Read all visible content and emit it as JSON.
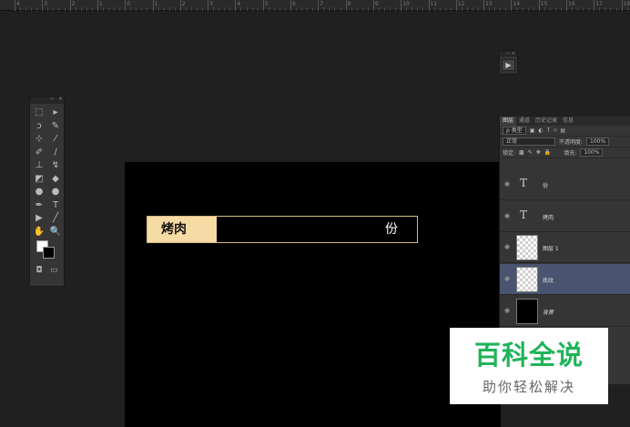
{
  "ruler": {
    "labels": [
      "4",
      "3",
      "2",
      "1",
      "0",
      "1",
      "2",
      "3",
      "4",
      "5",
      "6",
      "7",
      "8",
      "9",
      "10",
      "11",
      "12",
      "13",
      "14",
      "15",
      "16",
      "17",
      "18"
    ]
  },
  "tools_panel": {
    "tool_icons": [
      "marquee-icon",
      "move-icon",
      "lasso-icon",
      "quick-select-icon",
      "crop-icon",
      "eyedropper-icon",
      "healing-icon",
      "brush-icon",
      "stamp-icon",
      "history-brush-icon",
      "eraser-icon",
      "gradient-icon",
      "blur-icon",
      "dodge-icon",
      "pen-icon",
      "type-icon",
      "path-select-icon",
      "line-icon",
      "hand-icon",
      "zoom-icon"
    ],
    "tool_glyphs": [
      "⬚",
      "▸",
      "ↄ",
      "✎",
      "⊹",
      "⁄",
      "✐",
      "∕",
      "⊥",
      "↯",
      "◩",
      "◆",
      "●",
      "●",
      "✒",
      "T",
      "▶",
      "╱",
      "✋",
      "🔍"
    ],
    "foreground_color": "#ffffff",
    "background_color": "#000000"
  },
  "canvas": {
    "strip": {
      "label": "烤肉",
      "unit": "份",
      "label_bg": "#f7dba4",
      "border": "#d8b97a"
    }
  },
  "layers_panel": {
    "tabs": [
      "图层",
      "通道",
      "历史记录",
      "信息"
    ],
    "filter": {
      "label": "ρ 类型",
      "icons": [
        "image-filter-icon",
        "adjust-filter-icon",
        "type-filter-icon",
        "shape-filter-icon",
        "smart-filter-icon"
      ]
    },
    "blend_mode": "正常",
    "opacity_label": "不透明度:",
    "opacity_value": "100%",
    "lock_label": "锁定:",
    "fill_label": "填充:",
    "fill_value": "100%",
    "layers": [
      {
        "name": "份",
        "type": "text",
        "selected": false
      },
      {
        "name": "烤肉",
        "type": "text",
        "selected": false
      },
      {
        "name": "图层 1",
        "type": "pixel",
        "selected": false
      },
      {
        "name": "底纹",
        "type": "pixel",
        "selected": true
      },
      {
        "name": "背景",
        "type": "background",
        "selected": false
      }
    ]
  },
  "watermark": {
    "title": "百科全说",
    "subtitle": "助你轻松解决"
  }
}
